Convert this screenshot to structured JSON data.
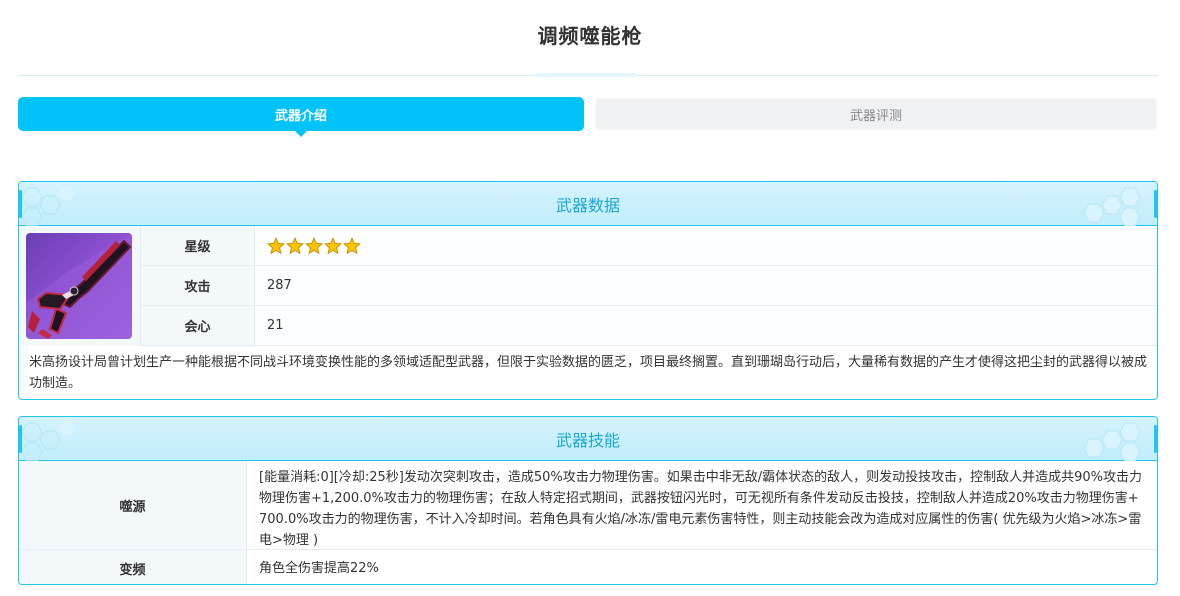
{
  "page": {
    "title": "调频噬能枪"
  },
  "tabs": [
    {
      "label": "武器介绍",
      "active": true
    },
    {
      "label": "武器评测",
      "active": false
    }
  ],
  "weapon_data": {
    "header": "武器数据",
    "stats": [
      {
        "label": "星级",
        "value": "",
        "stars": 5
      },
      {
        "label": "攻击",
        "value": "287"
      },
      {
        "label": "会心",
        "value": "21"
      }
    ],
    "description": "米高扬设计局曾计划生产一种能根据不同战斗环境变换性能的多领域适配型武器，但限于实验数据的匮乏，项目最终搁置。直到珊瑚岛行动后，大量稀有数据的产生才使得这把尘封的武器得以被成功制造。"
  },
  "weapon_skills": {
    "header": "武器技能",
    "skills": [
      {
        "name": "噬源",
        "desc": "[能量消耗:0][冷却:25秒]发动次突刺攻击，造成50%攻击力物理伤害。如果击中非无敌/霸体状态的敌人，则发动投技攻击，控制敌人并造成共90%攻击力物理伤害+1,200.0%攻击力的物理伤害；在敌人特定招式期间，武器按钮闪光时，可无视所有条件发动反击投技，控制敌人并造成20%攻击力物理伤害+ 700.0%攻击力的物理伤害，不计入冷却时间。若角色具有火焰/冰冻/雷电元素伤害特性，则主动技能会改为造成对应属性的伤害( 优先级为火焰>冰冻>雷电>物理 )"
      },
      {
        "name": "变频",
        "desc": "角色全伤害提高22%"
      }
    ]
  },
  "colors": {
    "accent": "#00c3f9",
    "border": "#20c5f1",
    "header_bg": "#c9effc",
    "header_text": "#1aa7d4",
    "star": "#f7c600"
  },
  "icons": {
    "star": "star-icon",
    "weapon": "weapon-image"
  }
}
